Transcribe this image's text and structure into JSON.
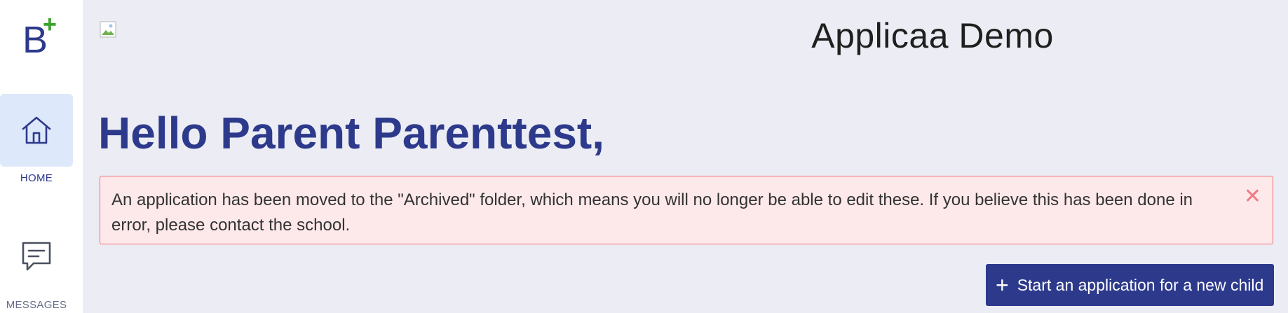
{
  "app": {
    "title": "Applicaa Demo",
    "logo_letter": "B",
    "logo_plus": "+"
  },
  "sidebar": {
    "items": [
      {
        "label": "HOME",
        "icon": "home-icon",
        "active": true
      },
      {
        "label": "MESSAGES",
        "icon": "chat-icon",
        "active": false
      }
    ]
  },
  "main": {
    "greeting": "Hello Parent Parenttest,",
    "alert": {
      "message": "An application has been moved to the \"Archived\" folder, which means you will no longer be able to edit these. If you believe this has been done in error, please contact the school.",
      "close_symbol": "✕"
    },
    "cta": {
      "icon": "+",
      "label": "Start an application for a new child"
    }
  },
  "colors": {
    "brand": "#2d3a8c",
    "brand_accent": "#3aa12c",
    "background": "#ecedf4",
    "alert_bg": "#fde8ea",
    "alert_border": "#ef6e74",
    "nav_active_bg": "#dde8fb"
  }
}
